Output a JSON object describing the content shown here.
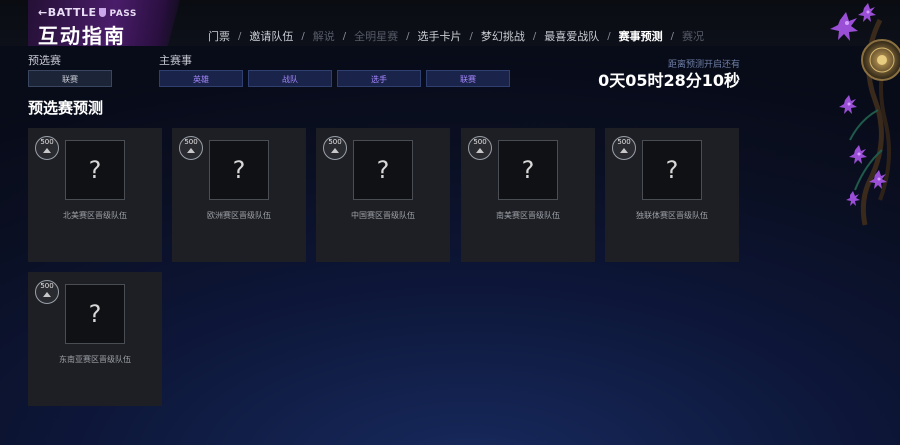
{
  "brand": {
    "top_prefix": "←BATTLE",
    "top_suffix": "PASS",
    "title": "互动指南"
  },
  "nav": {
    "tabs": [
      {
        "label": "门票",
        "state": "normal"
      },
      {
        "label": "邀请队伍",
        "state": "normal"
      },
      {
        "label": "解说",
        "state": "dim"
      },
      {
        "label": "全明星赛",
        "state": "dim"
      },
      {
        "label": "选手卡片",
        "state": "normal"
      },
      {
        "label": "梦幻挑战",
        "state": "normal"
      },
      {
        "label": "最喜爱战队",
        "state": "normal"
      },
      {
        "label": "赛事预测",
        "state": "active"
      },
      {
        "label": "赛况",
        "state": "dim"
      }
    ],
    "separator": "/"
  },
  "filters": {
    "qualifier_label": "预选赛",
    "qualifier_buttons": [
      "联赛"
    ],
    "main_label": "主赛事",
    "main_buttons": [
      "英雄",
      "战队",
      "选手",
      "联赛"
    ]
  },
  "countdown": {
    "label": "距离预测开启还有",
    "value": "0天05时28分10秒"
  },
  "section": {
    "title": "预选赛预测"
  },
  "cards": [
    {
      "cost": "500",
      "placeholder": "?",
      "team": "北美赛区晋级队伍"
    },
    {
      "cost": "500",
      "placeholder": "?",
      "team": "欧洲赛区晋级队伍"
    },
    {
      "cost": "500",
      "placeholder": "?",
      "team": "中国赛区晋级队伍"
    },
    {
      "cost": "500",
      "placeholder": "?",
      "team": "南美赛区晋级队伍"
    },
    {
      "cost": "500",
      "placeholder": "?",
      "team": "独联体赛区晋级队伍"
    },
    {
      "cost": "500",
      "placeholder": "?",
      "team": "东南亚赛区晋级队伍"
    }
  ],
  "colors": {
    "accent": "#a688ff",
    "card_bg": "#1e1f24",
    "brand_purple": "#4a1d6a"
  },
  "icons": {
    "cost_badge": "coin-icon",
    "decoration": "aegis-flower-icon"
  }
}
